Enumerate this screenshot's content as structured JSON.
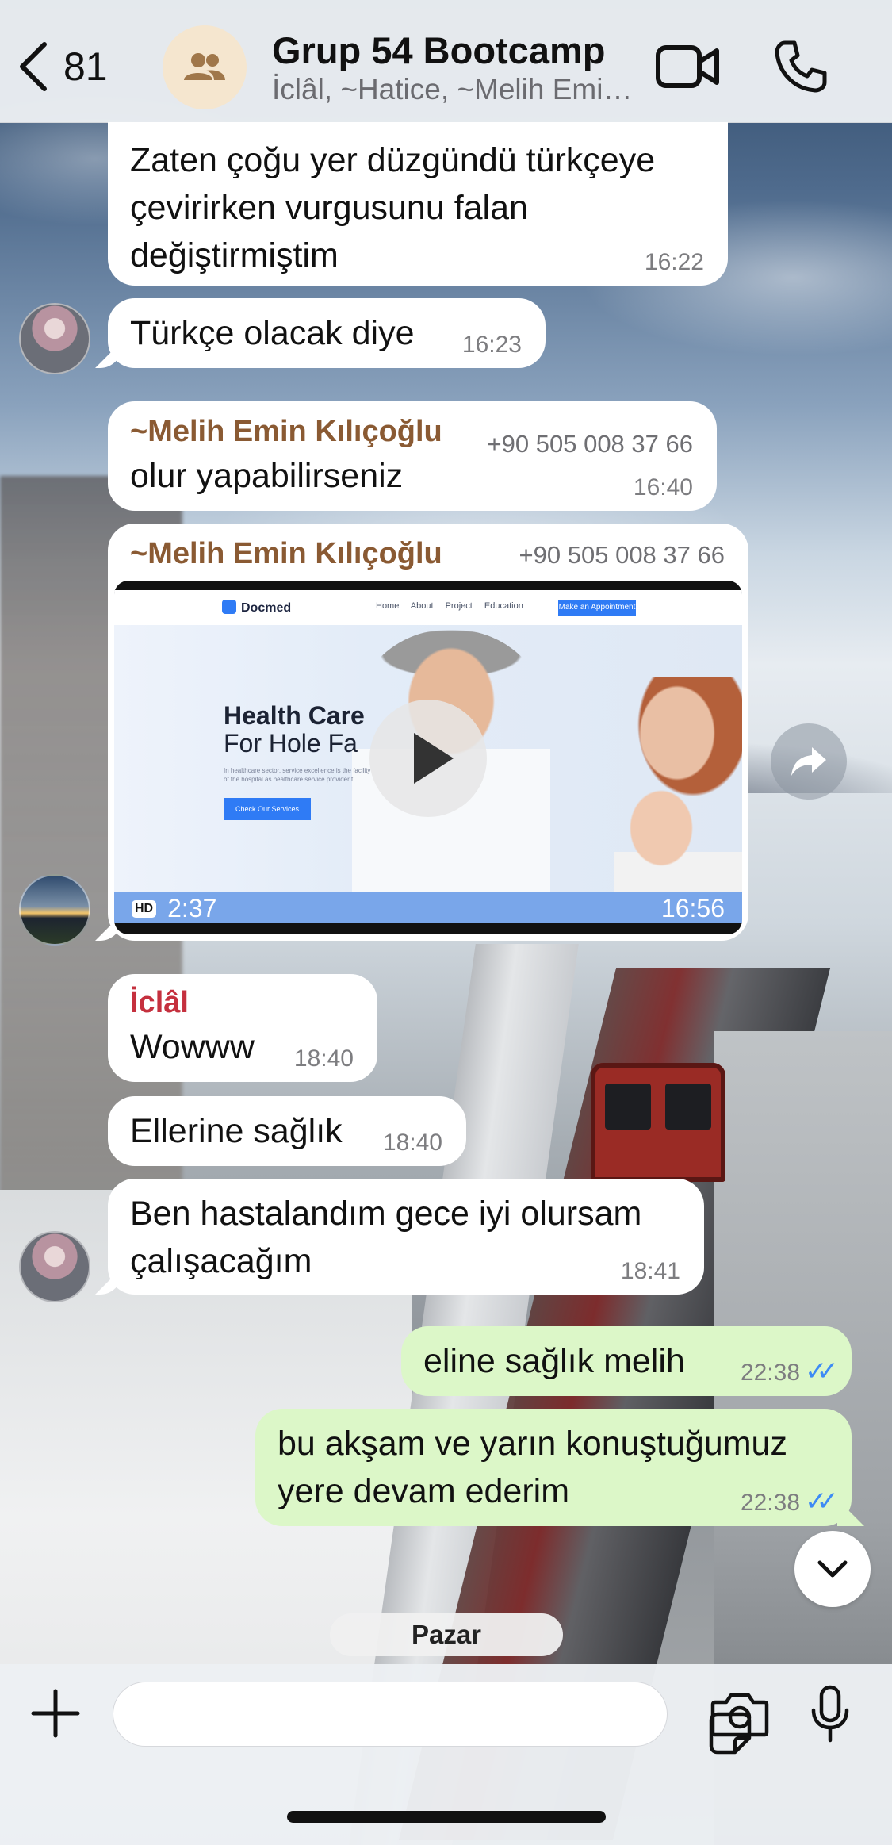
{
  "header": {
    "back_count": "81",
    "title": "Grup 54 Bootcamp",
    "subtitle": "İclâl, ~Hatice, ~Melih Emin Kılıçoğlu"
  },
  "messages": [
    {
      "text": "Zaten çoğu yer düzgündü türkçeye çevirirken vurgusunu falan değiştirmiştim",
      "time": "16:22"
    },
    {
      "text": "Türkçe olacak diye",
      "time": "16:23"
    },
    {
      "sender": "~Melih Emin Kılıçoğlu",
      "phone": "+90 505 008 37 66",
      "text": "olur yapabilirseniz",
      "time": "16:40"
    },
    {
      "sender": "~Melih Emin Kılıçoğlu",
      "phone": "+90 505 008 37 66",
      "video_duration": "2:37",
      "hd": "HD",
      "time": "16:56"
    },
    {
      "sender": "İclâl",
      "text": "Wowww",
      "time": "18:40"
    },
    {
      "text": "Ellerine sağlık",
      "time": "18:40"
    },
    {
      "text": "Ben hastalandım gece iyi olursam çalışacağım",
      "time": "18:41"
    },
    {
      "text": "eline sağlık melih",
      "time": "22:38",
      "status": "read"
    },
    {
      "text": "bu akşam ve yarın konuştuğumuz yere devam ederim",
      "time": "22:38",
      "status": "read"
    }
  ],
  "video_preview": {
    "brand": "Docmed",
    "menu": "Home About Project Education",
    "appointment": "Make an Appointment",
    "hero_title": "Health Care",
    "hero_sub": "For Hole Fa",
    "hero_text": "In healthcare sector, service excellence is the facility of the hospital as healthcare service provider t",
    "cta": "Check Our Services"
  },
  "date_label": "Pazar",
  "composer": {
    "placeholder": ""
  },
  "colors": {
    "incoming_bubble": "#ffffff",
    "outgoing_bubble": "#dcf7c8",
    "sender_brown": "#8a5a33",
    "sender_red": "#c5303e",
    "read_check": "#3d8bf5"
  }
}
